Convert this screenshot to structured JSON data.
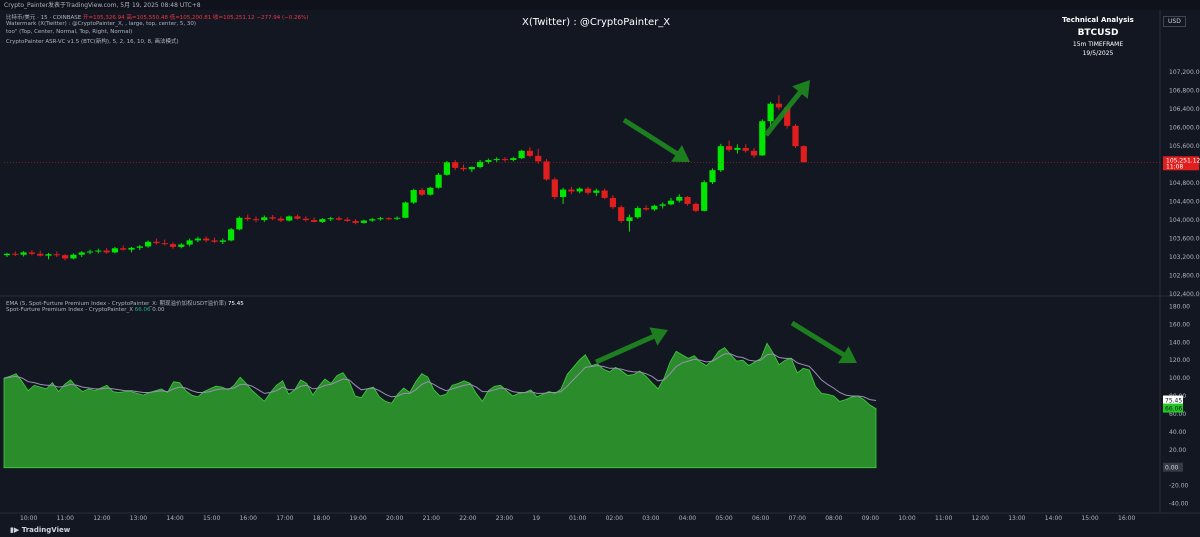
{
  "header": {
    "topbar_text": "Crypto_Painter发表于TradingView.com, 5月 19, 2025 08:48 UTC+8",
    "legend_line1_prefix": "比特币/美元 · 15 · COINBASE",
    "legend_line1_values": "开=105,326.94 高=105,550.48 低=105,200.81 收=105,251.12 −277.94 (−0.26%)",
    "legend_line2": "Watermark (X(Twitter) : @CryptoPainter_X, , large, top, center, 5, 30)",
    "legend_line3": "too\" (Top, Center, Normal, Top, Right, Normal)",
    "legend_line4": "CryptoPainter ASR-VC v1.5 (BTC(新构), 5, 2, 16, 10, 8, 画法模式)",
    "lower_legend1_prefix": "EMA (5, Spot-Furture Premium Index - CryptoPainter_X: 期现溢价加权USDT溢价率)",
    "lower_legend1_value": "75.45",
    "lower_legend2_prefix": "Spot-Furture Premium Index - CryptoPainter_X",
    "lower_legend2_value": "66.06",
    "lower_legend2_zero": "0.00"
  },
  "watermark": "X(Twitter) : @CryptoPainter_X",
  "info_box": {
    "title": "Technical Analysis",
    "symbol": "BTCUSD",
    "timeframe": "15m TIMEFRAME",
    "date": "19/5/2025"
  },
  "currency": "USD",
  "logo": "TradingView",
  "colors": {
    "background": "#131722",
    "up": "#00e600",
    "down": "#e01e1e",
    "premium_fill": "#2b8c2b",
    "ema_line": "#9b8fb5",
    "arrow": "#1f8a1f",
    "price_tag": "#e01e1e",
    "premium_tag": "#22c722"
  },
  "price_axis": [
    "107,200.00",
    "106,800.00",
    "106,400.00",
    "106,000.00",
    "105,600.00",
    "105,200.00",
    "104,800.00",
    "104,400.00",
    "104,000.00",
    "103,600.00",
    "103,200.00",
    "102,800.00",
    "102,400.00"
  ],
  "price_tag": {
    "value": "105,251.12",
    "countdown": "11:08"
  },
  "indicator_axis": [
    "180.00",
    "160.00",
    "140.00",
    "120.00",
    "100.00",
    "80.00",
    "60.00",
    "40.00",
    "20.00",
    "0.00",
    "-20.00",
    "-40.00"
  ],
  "indicator_tags": {
    "ema": "75.45",
    "premium": "66.06",
    "zero": "0.00"
  },
  "time_axis": [
    "10:00",
    "11:00",
    "12:00",
    "13:00",
    "14:00",
    "15:00",
    "16:00",
    "17:00",
    "18:00",
    "19:00",
    "20:00",
    "21:00",
    "22:00",
    "23:00",
    "19",
    "01:00",
    "02:00",
    "03:00",
    "04:00",
    "05:00",
    "06:00",
    "07:00",
    "08:00",
    "09:00",
    "10:00",
    "11:00",
    "12:00",
    "13:00",
    "14:00",
    "15:00",
    "16:00"
  ],
  "chart_data": [
    {
      "type": "candlestick",
      "title": "BTCUSD 15m",
      "ylim": [
        102400,
        107400
      ],
      "candles": [
        [
          103240,
          103290,
          103200,
          103270
        ],
        [
          103270,
          103320,
          103220,
          103250
        ],
        [
          103250,
          103330,
          103210,
          103300
        ],
        [
          103300,
          103350,
          103240,
          103270
        ],
        [
          103270,
          103340,
          103210,
          103230
        ],
        [
          103230,
          103290,
          103150,
          103260
        ],
        [
          103260,
          103320,
          103200,
          103240
        ],
        [
          103240,
          103260,
          103130,
          103170
        ],
        [
          103170,
          103280,
          103150,
          103250
        ],
        [
          103250,
          103330,
          103200,
          103300
        ],
        [
          103300,
          103360,
          103260,
          103320
        ],
        [
          103320,
          103380,
          103280,
          103340
        ],
        [
          103340,
          103390,
          103270,
          103300
        ],
        [
          103300,
          103420,
          103280,
          103390
        ],
        [
          103390,
          103450,
          103340,
          103360
        ],
        [
          103360,
          103420,
          103300,
          103400
        ],
        [
          103400,
          103460,
          103350,
          103430
        ],
        [
          103430,
          103560,
          103400,
          103530
        ],
        [
          103530,
          103600,
          103470,
          103500
        ],
        [
          103500,
          103580,
          103450,
          103480
        ],
        [
          103480,
          103520,
          103380,
          103420
        ],
        [
          103420,
          103500,
          103390,
          103470
        ],
        [
          103470,
          103600,
          103430,
          103560
        ],
        [
          103560,
          103640,
          103520,
          103600
        ],
        [
          103600,
          103650,
          103520,
          103560
        ],
        [
          103560,
          103620,
          103500,
          103530
        ],
        [
          103530,
          103600,
          103480,
          103560
        ],
        [
          103560,
          103830,
          103540,
          103800
        ],
        [
          103800,
          104080,
          103780,
          104050
        ],
        [
          104050,
          104120,
          103980,
          104020
        ],
        [
          104020,
          104080,
          103950,
          104000
        ],
        [
          104000,
          104100,
          103960,
          104060
        ],
        [
          104060,
          104110,
          104000,
          104030
        ],
        [
          104030,
          104080,
          103960,
          103990
        ],
        [
          103990,
          104100,
          103970,
          104080
        ],
        [
          104080,
          104120,
          104010,
          104030
        ],
        [
          104030,
          104080,
          103970,
          104000
        ],
        [
          104000,
          104060,
          103950,
          103960
        ],
        [
          103960,
          104040,
          103940,
          104020
        ],
        [
          104020,
          104070,
          103980,
          104040
        ],
        [
          104040,
          104080,
          103990,
          104010
        ],
        [
          104010,
          104060,
          103960,
          103980
        ],
        [
          103980,
          104020,
          103910,
          103940
        ],
        [
          103940,
          104010,
          103920,
          103990
        ],
        [
          103990,
          104050,
          103960,
          104020
        ],
        [
          104020,
          104070,
          103990,
          104040
        ],
        [
          104040,
          104060,
          104000,
          104030
        ],
        [
          104030,
          104080,
          104000,
          104050
        ],
        [
          104050,
          104400,
          104040,
          104380
        ],
        [
          104380,
          104680,
          104350,
          104650
        ],
        [
          104650,
          104700,
          104520,
          104550
        ],
        [
          104550,
          104720,
          104530,
          104700
        ],
        [
          104700,
          105020,
          104680,
          104980
        ],
        [
          104980,
          105280,
          104960,
          105250
        ],
        [
          105250,
          105300,
          105080,
          105130
        ],
        [
          105130,
          105200,
          105060,
          105100
        ],
        [
          105100,
          105160,
          105040,
          105150
        ],
        [
          105150,
          105300,
          105120,
          105260
        ],
        [
          105260,
          105330,
          105220,
          105300
        ],
        [
          105300,
          105360,
          105250,
          105320
        ],
        [
          105320,
          105360,
          105260,
          105300
        ],
        [
          105300,
          105370,
          105270,
          105340
        ],
        [
          105340,
          105520,
          105320,
          105500
        ],
        [
          105500,
          105580,
          105360,
          105390
        ],
        [
          105390,
          105540,
          105220,
          105270
        ],
        [
          105270,
          105320,
          104850,
          104880
        ],
        [
          104880,
          104920,
          104450,
          104500
        ],
        [
          104500,
          104700,
          104350,
          104660
        ],
        [
          104660,
          104720,
          104560,
          104620
        ],
        [
          104620,
          104710,
          104580,
          104680
        ],
        [
          104680,
          104720,
          104550,
          104590
        ],
        [
          104590,
          104680,
          104520,
          104640
        ],
        [
          104640,
          104680,
          104450,
          104480
        ],
        [
          104480,
          104540,
          104240,
          104280
        ],
        [
          104280,
          104320,
          103940,
          103980
        ],
        [
          103980,
          104120,
          103750,
          104060
        ],
        [
          104060,
          104300,
          104030,
          104260
        ],
        [
          104260,
          104320,
          104200,
          104230
        ],
        [
          104230,
          104330,
          104200,
          104310
        ],
        [
          104310,
          104380,
          104250,
          104340
        ],
        [
          104340,
          104480,
          104320,
          104420
        ],
        [
          104420,
          104560,
          104380,
          104500
        ],
        [
          104500,
          104520,
          104310,
          104350
        ],
        [
          104350,
          104380,
          104170,
          104200
        ],
        [
          104200,
          104860,
          104190,
          104820
        ],
        [
          104820,
          105120,
          104780,
          105080
        ],
        [
          105080,
          105650,
          105040,
          105600
        ],
        [
          105600,
          105720,
          105480,
          105520
        ],
        [
          105520,
          105640,
          105440,
          105560
        ],
        [
          105560,
          105640,
          105460,
          105500
        ],
        [
          105500,
          105560,
          105350,
          105400
        ],
        [
          105400,
          106180,
          105390,
          106140
        ],
        [
          106140,
          106560,
          106020,
          106520
        ],
        [
          106520,
          106700,
          106380,
          106440
        ],
        [
          106440,
          106460,
          105980,
          106040
        ],
        [
          106040,
          106080,
          105560,
          105600
        ],
        [
          105600,
          105620,
          105300,
          105251
        ]
      ]
    },
    {
      "type": "area",
      "title": "Spot-Furture Premium Index - CryptoPainter_X",
      "ylim": [
        -45,
        185
      ],
      "series": [
        {
          "name": "Spot-Furture Premium Index - CryptoPainter_X",
          "values": [
            100,
            102,
            105,
            96,
            86,
            92,
            90,
            88,
            95,
            85,
            93,
            98,
            90,
            85,
            88,
            86,
            89,
            92,
            85,
            84,
            85,
            85,
            83,
            81,
            84,
            86,
            88,
            84,
            96,
            95,
            86,
            81,
            79,
            85,
            88,
            91,
            90,
            87,
            92,
            101,
            94,
            86,
            80,
            74,
            84,
            92,
            97,
            82,
            87,
            98,
            94,
            81,
            91,
            99,
            94,
            103,
            106,
            96,
            80,
            78,
            88,
            90,
            79,
            74,
            72,
            82,
            89,
            84,
            96,
            105,
            101,
            87,
            80,
            82,
            92,
            94,
            97,
            94,
            83,
            74,
            86,
            91,
            92,
            86,
            80,
            83,
            84,
            87,
            79,
            82,
            85,
            83,
            88,
            104,
            112,
            120,
            126,
            114,
            116,
            110,
            107,
            112,
            108,
            103,
            104,
            108,
            102,
            95,
            88,
            100,
            118,
            130,
            126,
            122,
            125,
            118,
            114,
            120,
            130,
            134,
            126,
            119,
            120,
            114,
            118,
            122,
            139,
            128,
            115,
            120,
            122,
            106,
            111,
            109,
            91,
            83,
            82,
            80,
            74,
            76,
            79,
            80,
            76,
            70,
            66
          ]
        },
        {
          "name": "EMA (5, Spot-Furture Premium Index - CryptoPainter_X: 期现溢价加权USDT溢价率)",
          "values": [
            100,
            101,
            102,
            100,
            96,
            95,
            93,
            92,
            92,
            90,
            91,
            93,
            92,
            90,
            89,
            88,
            88,
            89,
            88,
            87,
            86,
            86,
            85,
            84,
            84,
            85,
            86,
            85,
            88,
            90,
            89,
            86,
            84,
            84,
            85,
            87,
            88,
            88,
            89,
            93,
            93,
            91,
            87,
            83,
            84,
            86,
            90,
            87,
            87,
            91,
            92,
            88,
            89,
            92,
            93,
            96,
            99,
            98,
            92,
            87,
            88,
            89,
            86,
            82,
            79,
            80,
            83,
            83,
            87,
            93,
            96,
            93,
            89,
            86,
            88,
            90,
            92,
            93,
            90,
            85,
            85,
            87,
            89,
            88,
            85,
            84,
            84,
            85,
            83,
            83,
            84,
            84,
            85,
            91,
            98,
            105,
            112,
            113,
            114,
            113,
            111,
            111,
            110,
            108,
            107,
            107,
            105,
            102,
            97,
            98,
            105,
            113,
            117,
            119,
            121,
            120,
            118,
            119,
            123,
            127,
            127,
            124,
            123,
            120,
            119,
            120,
            126,
            127,
            123,
            122,
            122,
            117,
            115,
            113,
            106,
            98,
            93,
            89,
            84,
            81,
            80,
            80,
            79,
            76,
            75
          ]
        }
      ]
    }
  ]
}
